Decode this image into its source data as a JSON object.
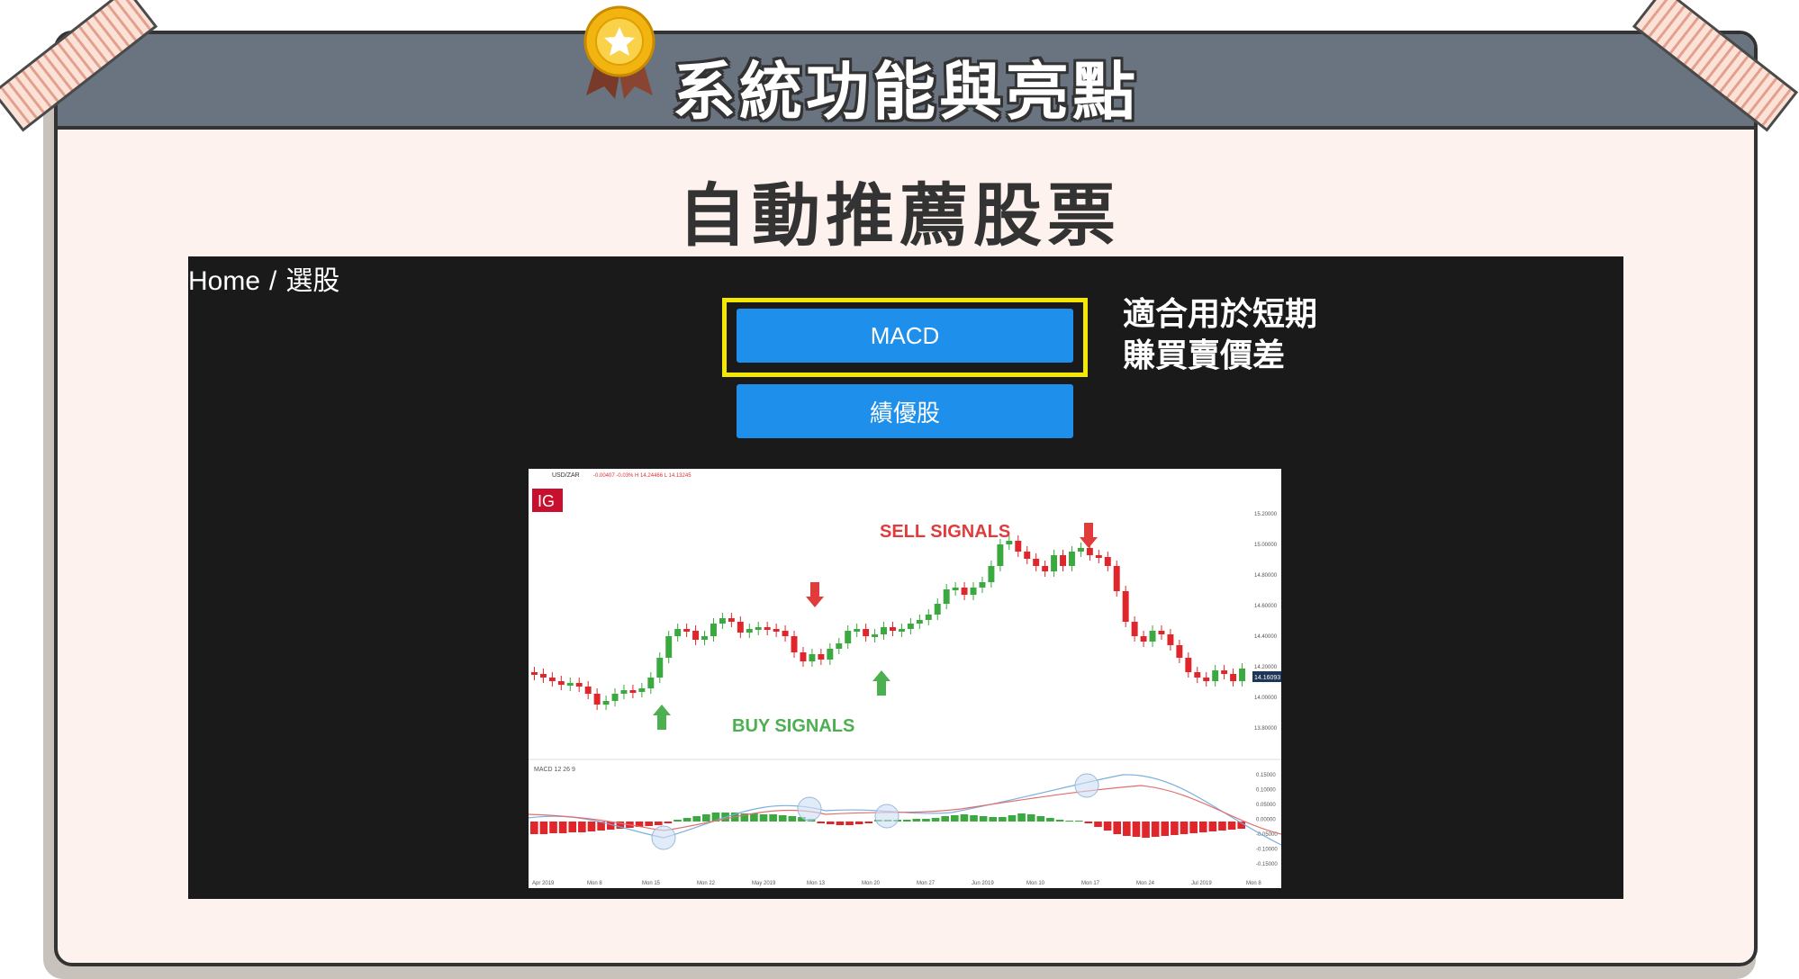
{
  "header": {
    "title": "系統功能與亮點",
    "icon": "medal-icon"
  },
  "section": {
    "title": "自動推薦股票"
  },
  "app": {
    "breadcrumb": {
      "home": "Home",
      "separator": "/",
      "current": "選股"
    },
    "buttons": {
      "macd": "MACD",
      "blue_chip": "績優股"
    },
    "note": [
      "適合用於短期",
      "賺買賣價差"
    ]
  },
  "chart": {
    "symbol": "USD/ZAR",
    "quote": "-0.00407 -0.03% H 14.24466 L 14.13245",
    "logo": "IG",
    "sell_label": "SELL SIGNALS",
    "buy_label": "BUY SIGNALS",
    "current_price": "14.16093",
    "macd_label": "MACD  12  26  9",
    "price_axis": [
      "15.20000",
      "15.00000",
      "14.80000",
      "14.60000",
      "14.40000",
      "14.20000",
      "14.00000",
      "13.80000"
    ],
    "macd_axis": [
      "0.15000",
      "0.10000",
      "0.05000",
      "0.00000",
      "-0.05000",
      "-0.10000",
      "-0.15000"
    ],
    "x_axis": [
      "Apr 2019",
      "Mon 8",
      "Mon 15",
      "Mon 22",
      "May 2019",
      "Mon 13",
      "Mon 20",
      "Mon 27",
      "Jun 2019",
      "Mon 10",
      "Mon 17",
      "Mon 24",
      "Jul 2019",
      "Mon 8"
    ],
    "colors": {
      "up": "#3aa93f",
      "down": "#e0262b",
      "sell": "#e03c3c",
      "buy": "#4caf50",
      "macd_line": "#7aaee0",
      "signal_line": "#e07070"
    }
  }
}
